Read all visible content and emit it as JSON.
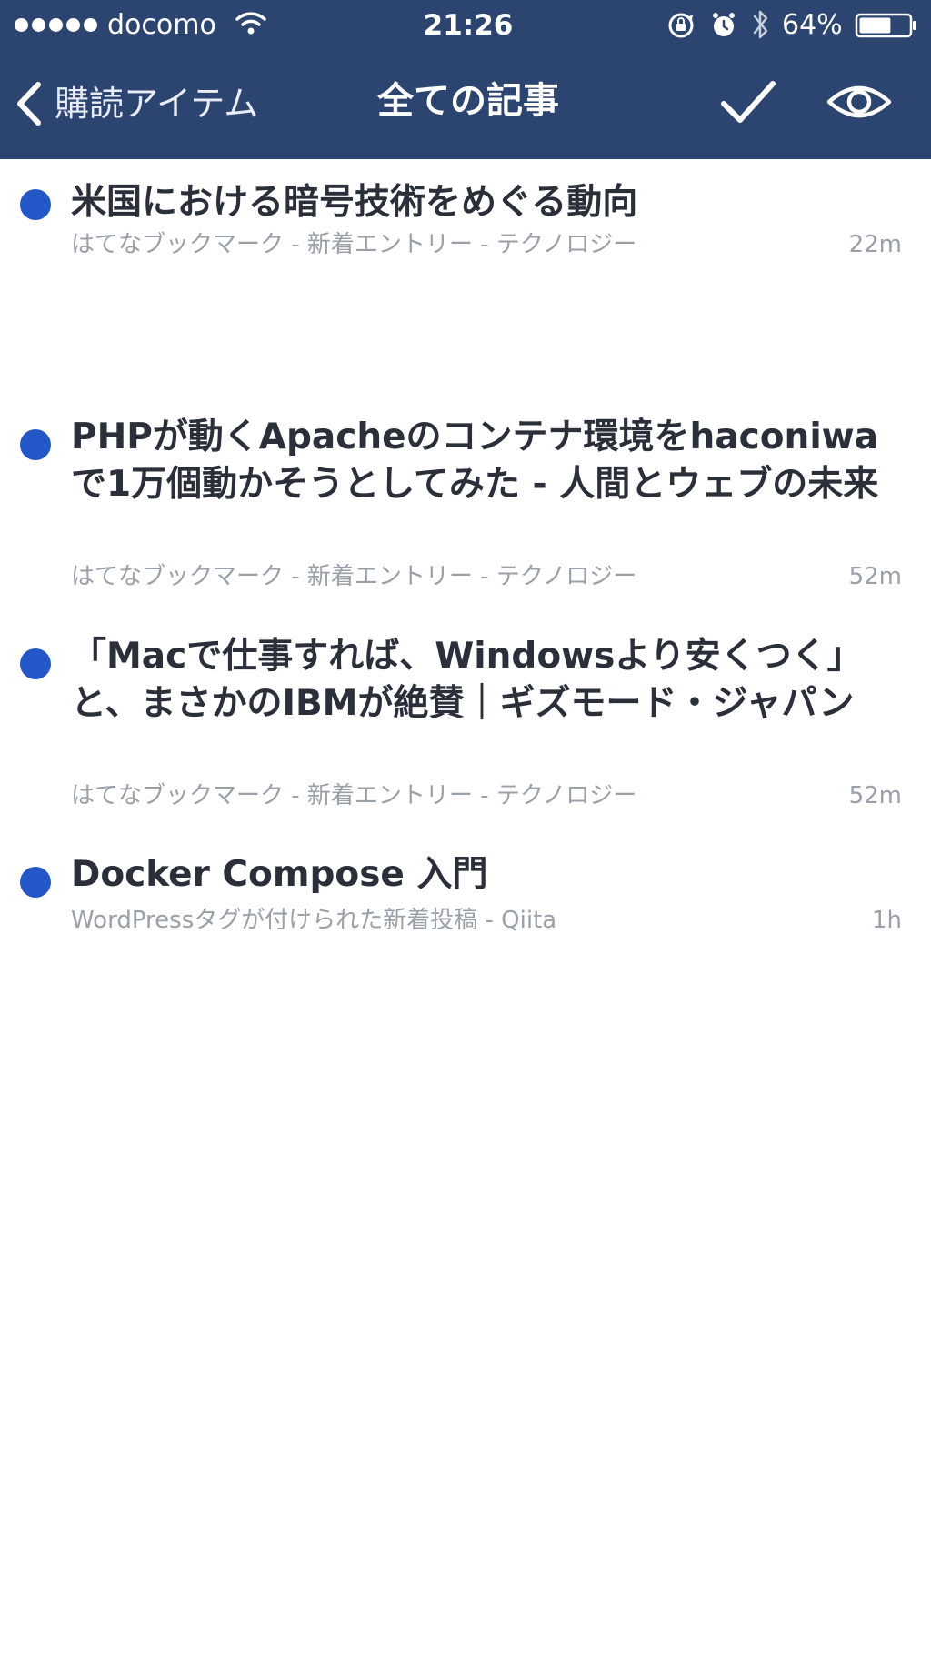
{
  "status_bar": {
    "signal_icon": "signal-dots-icon",
    "carrier": "docomo",
    "wifi_icon": "wifi-icon",
    "time": "21:26",
    "lock_icon": "rotation-lock-icon",
    "alarm_icon": "alarm-icon",
    "bluetooth_icon": "bluetooth-icon",
    "battery_percent": "64%",
    "battery_level": 0.64
  },
  "nav_bar": {
    "back_label": "購読アイテム",
    "title": "全ての記事",
    "mark_read_icon": "checkmark-icon",
    "view_icon": "eye-icon"
  },
  "colors": {
    "nav_background": "#2c4470",
    "unread_dot": "#2356c7",
    "title_text": "#2a2f3a",
    "meta_text": "#9aa0a8"
  },
  "articles": [
    {
      "title": "米国における暗号技術をめぐる動向",
      "source": "はてなブックマーク - 新着エントリー - テクノロジー",
      "time": "22m",
      "unread": true
    },
    {
      "title": "PHPが動くApacheのコンテナ環境をhaconiwaで1万個動かそうとしてみた - 人間とウェブの未来",
      "source": "はてなブックマーク - 新着エントリー - テクノロジー",
      "time": "52m",
      "unread": true
    },
    {
      "title": "「Macで仕事すれば、Windowsより安くつく」と、まさかのIBMが絶賛｜ギズモード・ジャパン",
      "source": "はてなブックマーク - 新着エントリー - テクノロジー",
      "time": "52m",
      "unread": true
    },
    {
      "title": "Docker Compose 入門",
      "source": "WordPressタグが付けられた新着投稿 - Qiita",
      "time": "1h",
      "unread": true
    }
  ]
}
